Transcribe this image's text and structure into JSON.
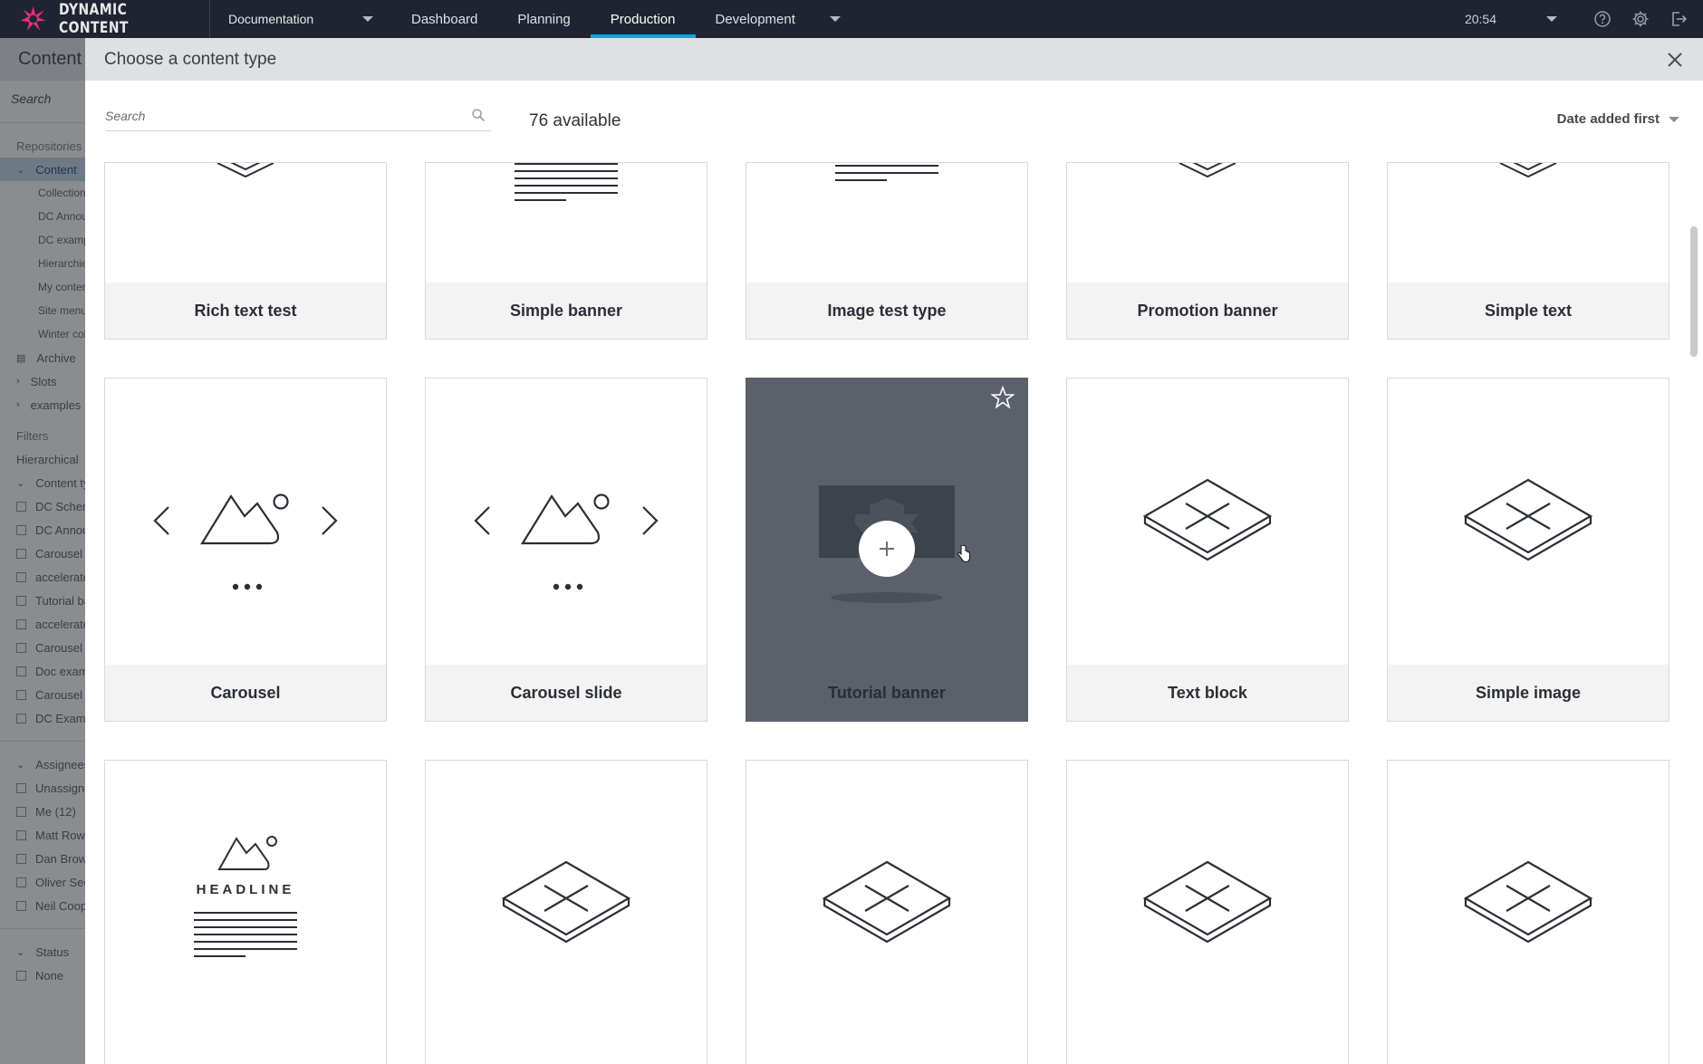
{
  "brand": {
    "name": "DYNAMIC CONTENT",
    "logo_icon": "starburst-logo-icon",
    "accent": "#e62e7c"
  },
  "topnav": {
    "hub": "Documentation",
    "items": [
      {
        "label": "Dashboard"
      },
      {
        "label": "Planning"
      },
      {
        "label": "Production",
        "active": true
      },
      {
        "label": "Development"
      }
    ],
    "time": "20:54"
  },
  "background_page": {
    "title": "Content",
    "search_placeholder": "Search",
    "repositories_heading": "Repositories",
    "repo_content": "Content",
    "repo_items": [
      "Collections",
      "DC Announcements",
      "DC examples",
      "Hierarchies",
      "My content",
      "Site menu",
      "Winter collection"
    ],
    "archive": "Archive",
    "slots": "Slots",
    "examples": "examples",
    "filters_heading": "Filters",
    "hierarchical": "Hierarchical",
    "content_type_heading": "Content type",
    "content_type_items": [
      "DC Schema",
      "DC Announcements",
      "Carousel",
      "accelerated",
      "Tutorial banner",
      "accelerated",
      "Carousel",
      "Doc examples",
      "Carousel",
      "DC Examples"
    ],
    "assignees_heading": "Assignees",
    "assignee_items": [
      "Unassigned",
      "Me (12)",
      "Matt Row",
      "Dan Brown",
      "Oliver Sec",
      "Neil Coop"
    ],
    "status_heading": "Status",
    "status_items": [
      "None"
    ]
  },
  "modal": {
    "title": "Choose a content type",
    "search_placeholder": "Search",
    "count_text": "76 available",
    "sort_label": "Date added first",
    "cards_row1": [
      "Rich text test",
      "Simple banner",
      "Image test type",
      "Promotion banner",
      "Simple text"
    ],
    "cards_row2": [
      "Carousel",
      "Carousel slide",
      "Tutorial banner",
      "Text block",
      "Simple image"
    ],
    "headline_text": "HEADLINE",
    "hovered_card": "Tutorial banner"
  },
  "colors": {
    "topbar": "#1f2430",
    "active_tab": "#1a9fe0",
    "hover_card": "#5b606b"
  }
}
